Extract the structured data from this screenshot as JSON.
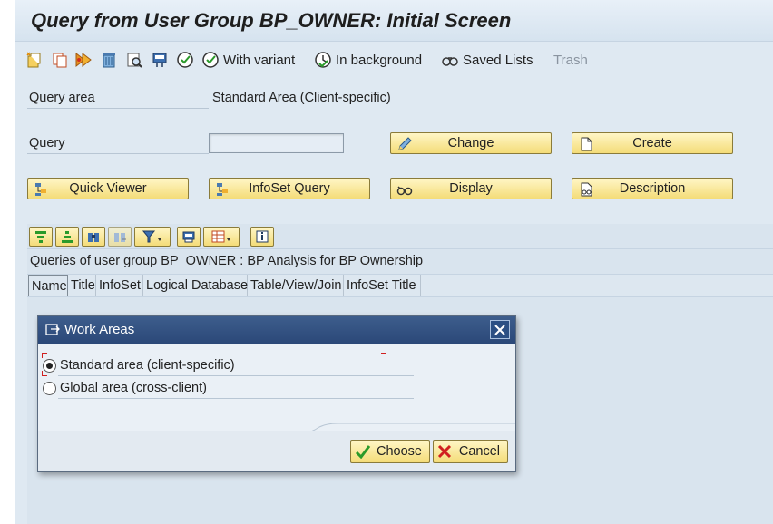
{
  "title": "Query from User Group BP_OWNER: Initial Screen",
  "toolbar": {
    "icons": [
      "new-document-icon",
      "copy-icon",
      "execute-icon",
      "delete-icon",
      "find-icon",
      "print-icon",
      "execute-clock-icon"
    ],
    "with_variant": "With variant",
    "in_background": "In background",
    "saved_lists": "Saved Lists",
    "trash": "Trash"
  },
  "form": {
    "query_area_label": "Query area",
    "query_area_value": "Standard Area (Client-specific)",
    "query_label": "Query",
    "query_value": ""
  },
  "buttons": {
    "change": "Change",
    "create": "Create",
    "quick_viewer": "Quick Viewer",
    "infoset_query": "InfoSet Query",
    "display": "Display",
    "description": "Description"
  },
  "alv": {
    "title": "Queries of user group BP_OWNER : BP Analysis for BP Ownership",
    "columns": [
      "Name",
      "Title",
      "InfoSet",
      "Logical Database",
      "Table/View/Join",
      "InfoSet Title"
    ]
  },
  "dialog": {
    "title": "Work Areas",
    "options": [
      {
        "label": "Standard area (client-specific)",
        "selected": true
      },
      {
        "label": "Global area (cross-client)",
        "selected": false
      }
    ],
    "choose": "Choose",
    "cancel": "Cancel"
  },
  "colors": {
    "background": "#dfe9f2",
    "button_yellow": "#f4dc78",
    "dialog_title": "#2b4878"
  }
}
